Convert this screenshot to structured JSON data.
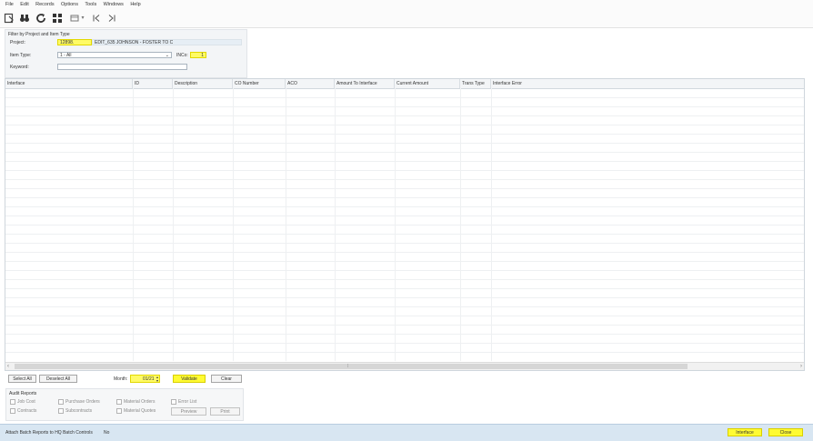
{
  "menu": [
    "File",
    "Edit",
    "Records",
    "Options",
    "Tools",
    "Windows",
    "Help"
  ],
  "filter": {
    "title": "Filter by Project and Item Type",
    "project_label": "Project:",
    "project_value": "12898.",
    "project_desc": "EDIT_635 JOHNSON - FOSTER TO C",
    "item_type_label": "Item Type:",
    "item_type_value": "1 - All",
    "inco_label": "INCo:",
    "inco_value": "1",
    "keyword_label": "Keyword:",
    "keyword_value": ""
  },
  "grid": {
    "columns": [
      "Interface",
      "ID",
      "Description",
      "CO Number",
      "ACO",
      "Amount To Interface",
      "Current Amount",
      "Trans Type",
      "Interface Error"
    ],
    "rows": []
  },
  "actions": {
    "select_all": "Select All",
    "deselect_all": "Deselect All",
    "month_label": "Month:",
    "month_value": "01/21",
    "validate": "Validate",
    "clear": "Clear"
  },
  "audit": {
    "title": "Audit Reports",
    "checks": [
      "Job Cost",
      "Purchase Orders",
      "Material Orders",
      "Error List",
      "Contracts",
      "Subcontracts",
      "Material Quotes"
    ],
    "preview": "Preview",
    "print": "Print"
  },
  "status": {
    "attach_label": "Attach Batch Reports to HQ Batch Controls",
    "attach_value": "No",
    "interface": "Interface",
    "clear": "Close"
  },
  "colors": {
    "highlight": "#fffb33",
    "status_bar": "#d8e6f2"
  },
  "icons": [
    "new-record-icon",
    "binoculars-icon",
    "refresh-icon",
    "grid-icon",
    "table-dropdown-icon",
    "first-record-icon",
    "last-record-icon"
  ]
}
